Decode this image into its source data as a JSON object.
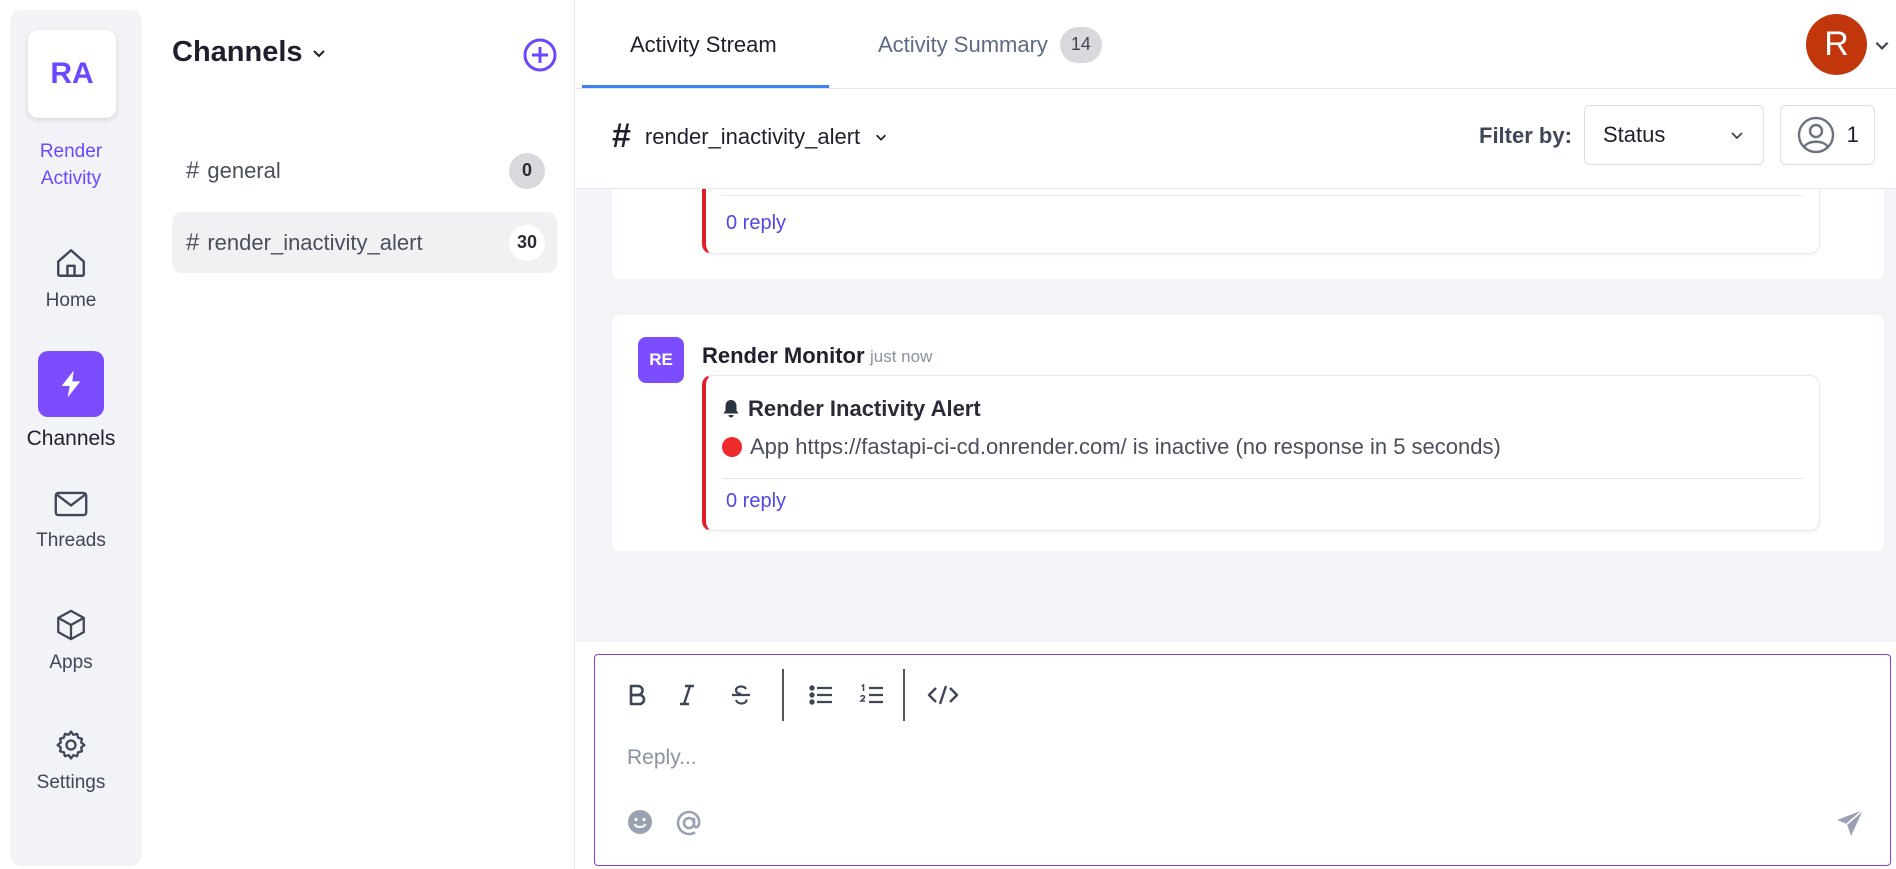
{
  "workspace": {
    "initials": "RA",
    "name_line1": "Render",
    "name_line2": "Activity"
  },
  "nav": {
    "home": "Home",
    "channels": "Channels",
    "threads": "Threads",
    "apps": "Apps",
    "settings": "Settings"
  },
  "channels_panel": {
    "title": "Channels",
    "items": [
      {
        "name": "general",
        "count": "0"
      },
      {
        "name": "render_inactivity_alert",
        "count": "30"
      }
    ]
  },
  "tabs": {
    "stream": "Activity Stream",
    "summary": "Activity Summary",
    "summary_badge": "14"
  },
  "user": {
    "avatar_initial": "R"
  },
  "subbar": {
    "channel": "render_inactivity_alert",
    "filter_label": "Filter by:",
    "filter_value": "Status",
    "members_count": "1"
  },
  "messages": [
    {
      "reply_text": "0 reply"
    },
    {
      "sender_initials": "RE",
      "sender": "Render Monitor",
      "time": "just now",
      "alert_title": "Render Inactivity Alert",
      "alert_body": "App https://fastapi-ci-cd.onrender.com/ is inactive (no response in 5 seconds)",
      "reply_text": "0 reply"
    }
  ],
  "editor": {
    "placeholder": "Reply..."
  },
  "colors": {
    "accent": "#7c4dff",
    "alert_red": "#e11d2a",
    "link": "#4f46e5",
    "avatar_bg": "#c2360b"
  }
}
